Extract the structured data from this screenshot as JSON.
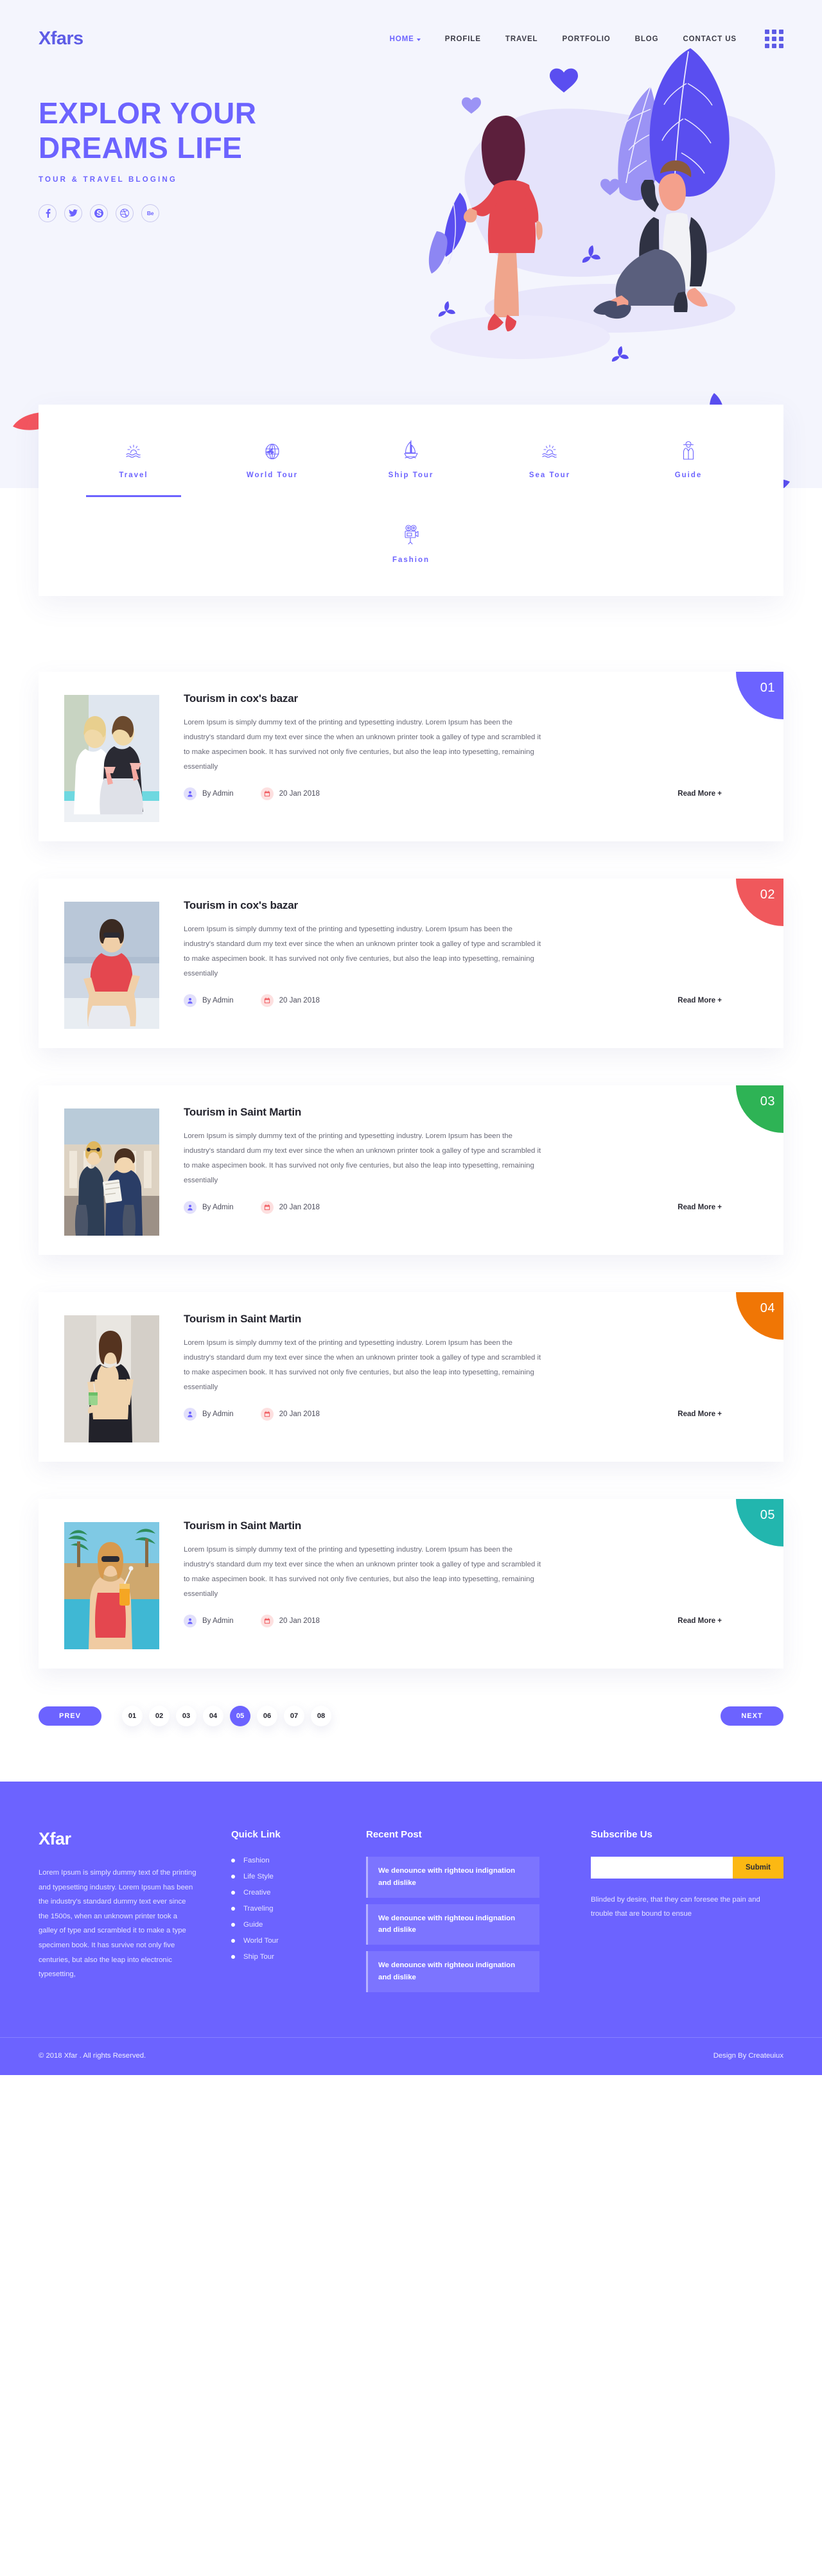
{
  "brand": {
    "logo": "Xfars",
    "accent": "#6c63ff"
  },
  "nav": {
    "items": [
      {
        "label": "HOME",
        "active": true,
        "has_caret": true
      },
      {
        "label": "PROFILE",
        "active": false,
        "has_caret": false
      },
      {
        "label": "TRAVEL",
        "active": false,
        "has_caret": false
      },
      {
        "label": "PORTFOLIO",
        "active": false,
        "has_caret": false
      },
      {
        "label": "BLOG",
        "active": false,
        "has_caret": false
      },
      {
        "label": "CONTACT US",
        "active": false,
        "has_caret": false
      }
    ],
    "grid_button": "grid-menu-icon"
  },
  "hero": {
    "title_line1": "EXPLOR YOUR",
    "title_line2": "DREAMS LIFE",
    "subtitle": "TOUR & TRAVEL BLOGING",
    "socials": [
      {
        "name": "facebook-icon",
        "glyph": "f"
      },
      {
        "name": "twitter-icon",
        "glyph": "t"
      },
      {
        "name": "skype-icon",
        "glyph": "S"
      },
      {
        "name": "dribbble-icon",
        "glyph": "d"
      },
      {
        "name": "behance-icon",
        "glyph": "Be"
      }
    ]
  },
  "tabs": {
    "row1": [
      {
        "label": "Travel",
        "icon": "sunset-sea-icon",
        "active": true
      },
      {
        "label": "World Tour",
        "icon": "globe-plane-icon",
        "active": false
      },
      {
        "label": "Ship Tour",
        "icon": "sailboat-icon",
        "active": false
      },
      {
        "label": "Sea Tour",
        "icon": "sunset-sea-icon",
        "active": false
      },
      {
        "label": "Guide",
        "icon": "guide-person-icon",
        "active": false
      }
    ],
    "row2": [
      {
        "label": "Fashion",
        "icon": "movie-camera-icon",
        "active": false
      }
    ]
  },
  "blog": {
    "body_text": "Lorem Ipsum is simply dummy text of the printing and typesetting industry. Lorem Ipsum has been the industry's standard dum my text ever since the when an unknown printer took a galley of type and scrambled it to make aspecimen book. It has survived not only five centuries, but also the leap into typesetting, remaining essentially",
    "author": "By Admin",
    "date": "20 Jan 2018",
    "read_more": "Read More +",
    "posts": [
      {
        "number": "01",
        "title": "Tourism in cox's bazar",
        "badge_color": "#6c63ff",
        "photo": "two-women-cocktails"
      },
      {
        "number": "02",
        "title": "Tourism in cox's bazar",
        "badge_color": "#f0585c",
        "photo": "woman-sunglasses-sitting"
      },
      {
        "number": "03",
        "title": "Tourism in Saint Martin",
        "badge_color": "#2eb355",
        "photo": "couple-with-map"
      },
      {
        "number": "04",
        "title": "Tourism in Saint Martin",
        "badge_color": "#f07605",
        "photo": "woman-drink-white-wall"
      },
      {
        "number": "05",
        "title": "Tourism in Saint Martin",
        "badge_color": "#22b6ae",
        "photo": "woman-poolside-juice"
      }
    ]
  },
  "pagination": {
    "prev": "PREV",
    "next": "NEXT",
    "pages": [
      "01",
      "02",
      "03",
      "04",
      "05",
      "06",
      "07",
      "08"
    ],
    "active": "05"
  },
  "footer": {
    "logo": "Xfar",
    "about": "Lorem Ipsum is simply dummy text of the printing and typesetting industry. Lorem Ipsum has been the industry's standard dummy text ever since the 1500s, when an unknown printer took a galley of type and scrambled it to make a type specimen book. It has survive not only five centuries, but also the leap into electronic typesetting,",
    "quick_link": {
      "heading": "Quick Link",
      "items": [
        "Fashion",
        "Life Style",
        "Creative",
        "Traveling",
        "Guide",
        "World Tour",
        "Ship Tour"
      ]
    },
    "recent_post": {
      "heading": "Recent Post",
      "items": [
        "We denounce with righteou indignation and dislike",
        "We denounce with righteou indignation and dislike",
        "We denounce with righteou indignation and dislike"
      ]
    },
    "subscribe": {
      "heading": "Subscribe Us",
      "input_value": "",
      "input_placeholder": "",
      "submit": "Submit",
      "note": "Blinded by desire, that they can foresee the pain and trouble that are bound to ensue"
    },
    "copyright": "© 2018 Xfar . All rights Reserved.",
    "credit": "Design By Createuiux"
  }
}
